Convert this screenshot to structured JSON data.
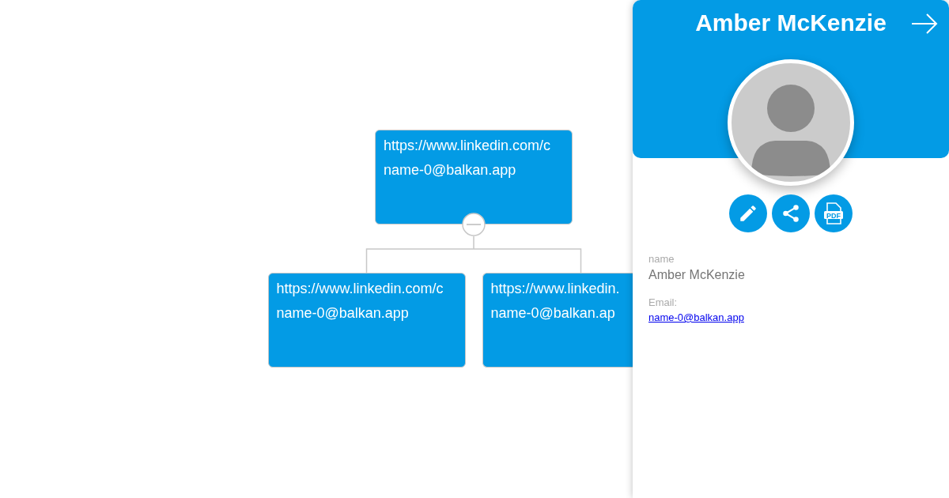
{
  "org_chart": {
    "root": {
      "url": "https://www.linkedin.com/c",
      "email": "name-0@balkan.app",
      "expanded": true,
      "children": [
        {
          "url": "https://www.linkedin.com/c",
          "email": "name-0@balkan.app"
        },
        {
          "url": "https://www.linkedin.",
          "email": "name-0@balkan.ap"
        }
      ]
    }
  },
  "details_panel": {
    "title": "Amber McKenzie",
    "actions": [
      {
        "kind": "edit"
      },
      {
        "kind": "share"
      },
      {
        "kind": "pdf",
        "label": "PDF"
      }
    ],
    "fields": [
      {
        "kind": "text",
        "label": "name",
        "value": "Amber McKenzie"
      },
      {
        "kind": "link",
        "label": "Email:",
        "value": "name-0@balkan.app"
      }
    ]
  }
}
